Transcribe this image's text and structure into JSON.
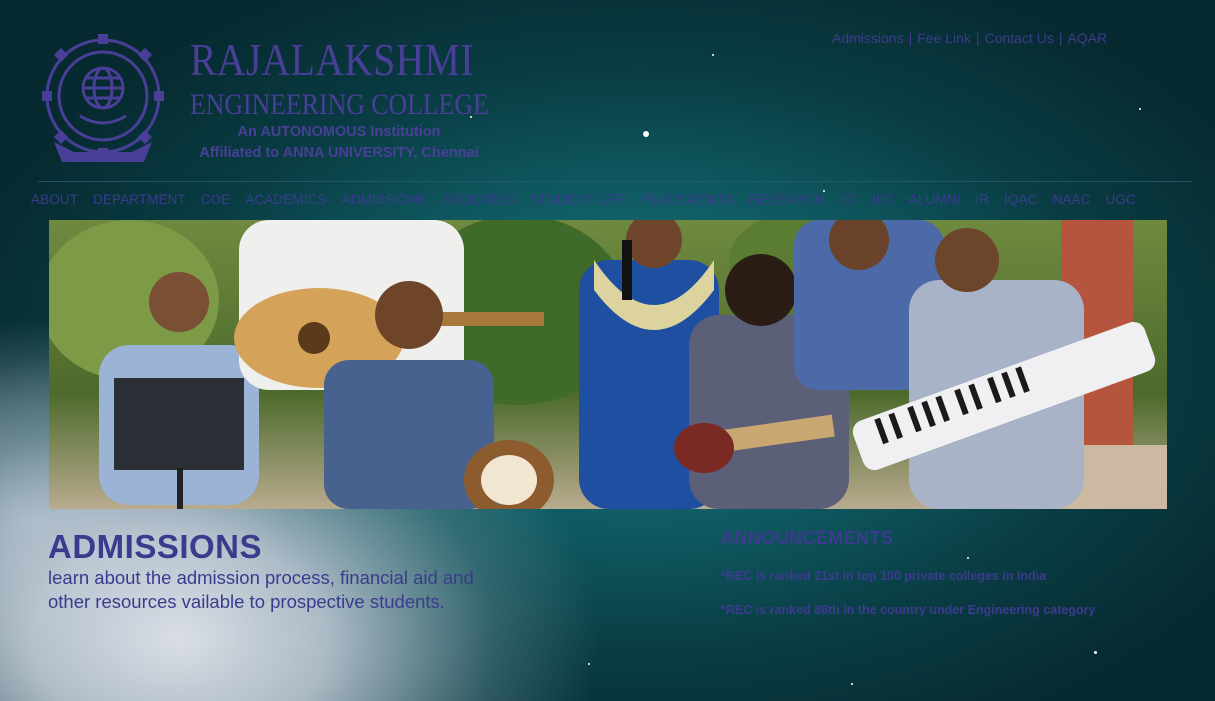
{
  "header": {
    "college_name": "RAJALAKSHMI",
    "college_subtitle": "ENGINEERING COLLEGE",
    "tagline": "An AUTONOMOUS Institution",
    "affiliation": "Affiliated to ANNA UNIVERSITY, Chennai",
    "top_links": [
      {
        "label": "Admissions"
      },
      {
        "label": "Fee Link"
      },
      {
        "label": "Contact Us"
      },
      {
        "label": "AQAR"
      }
    ],
    "top_link_separator": "|"
  },
  "nav": {
    "items": [
      {
        "label": "ABOUT"
      },
      {
        "label": "DEPARTMENT"
      },
      {
        "label": "COE"
      },
      {
        "label": "ACADEMICS"
      },
      {
        "label": "ADMISSIONS"
      },
      {
        "label": "FACILITIES"
      },
      {
        "label": "STUDENT LIFE"
      },
      {
        "label": "PLACEMENTS"
      },
      {
        "label": "RESEARCH"
      },
      {
        "label": "IIC"
      },
      {
        "label": "IIIC"
      },
      {
        "label": "ALUMNI"
      },
      {
        "label": "IR"
      },
      {
        "label": "IQAC"
      },
      {
        "label": "NAAC"
      },
      {
        "label": "UGC"
      }
    ]
  },
  "admissions": {
    "title": "ADMISSIONS",
    "description": "learn about the admission process, financial aid and other resources vailable to prospective students."
  },
  "announcements": {
    "title": "ANNOUNCEMENTS",
    "items": [
      {
        "text": "*REC is ranked 21st in top 100 private colleges in India"
      },
      {
        "text": "*REC is ranked 86th in the country under Engineering category"
      }
    ]
  },
  "colors": {
    "brand_purple": "#4a3f98",
    "link_color": "#3b3b8e",
    "background_teal": "#0f5a62"
  }
}
